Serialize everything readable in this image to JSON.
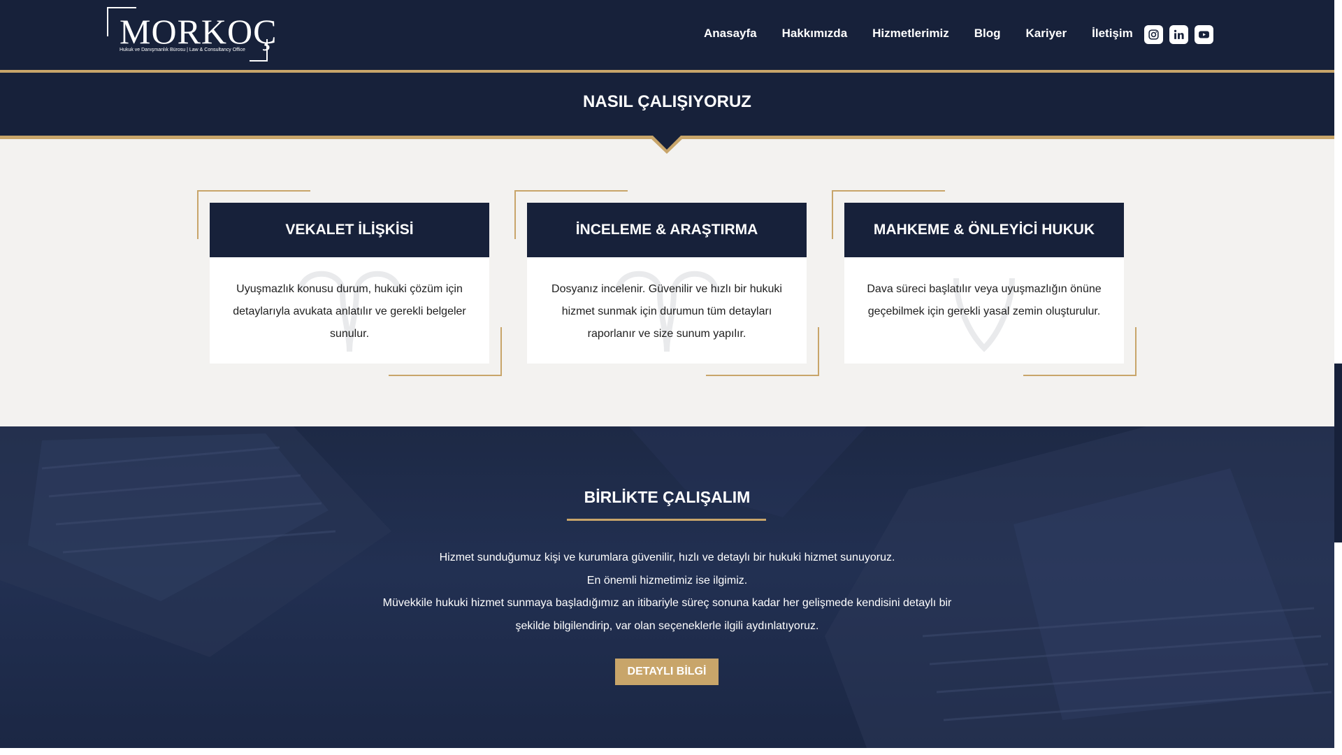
{
  "header": {
    "logo_text": "MORKOÇ",
    "logo_subtitle": "Hukuk ve Danışmanlık Bürosu | Law & Consultancy Office",
    "nav": [
      "Anasayfa",
      "Hakkımızda",
      "Hizmetlerimiz",
      "Blog",
      "Kariyer",
      "İletişim"
    ],
    "social_icons": [
      "instagram-icon",
      "linkedin-icon",
      "youtube-icon"
    ]
  },
  "process": {
    "title": "NASIL ÇALIŞIYORUZ",
    "cards": [
      {
        "title": "VEKALET İLİŞKİSİ",
        "lines": [
          "Uyuşmazlık konusu durum, hukuki çözüm için",
          "detaylarıyla avukata anlatılır ve gerekli belgeler",
          "sunulur."
        ]
      },
      {
        "title": "İNCELEME & ARAŞTIRMA",
        "lines": [
          "Dosyanız incelenir. Güvenilir ve hızlı bir hukuki",
          "hizmet sunmak için durumun tüm detayları",
          "raporlanır ve size sunum yapılır."
        ]
      },
      {
        "title": "MAHKEME & ÖNLEYİCİ HUKUK",
        "lines": [
          "Dava süreci başlatılır veya uyuşmazlığın önüne",
          "geçebilmek için gerekli yasal zemin oluşturulur."
        ]
      }
    ]
  },
  "cta": {
    "title": "BİRLİKTE ÇALIŞALIM",
    "lines": [
      "Hizmet sunduğumuz kişi ve kurumlara güvenilir, hızlı ve detaylı bir hukuki hizmet sunuyoruz.",
      "En önemli hizmetimiz ise ilgimiz.",
      "Müvekkile hukuki hizmet sunmaya başladığımız an itibariyle süreç sonuna kadar her gelişmede kendisini detaylı bir",
      "şekilde bilgilendirip, var olan seçeneklerle ilgili aydınlatıyoruz."
    ],
    "button_label": "DETAYLI BİLGİ"
  },
  "colors": {
    "navy": "#17213a",
    "gold": "#c8a56a",
    "page_bg": "#f3f2f0"
  }
}
